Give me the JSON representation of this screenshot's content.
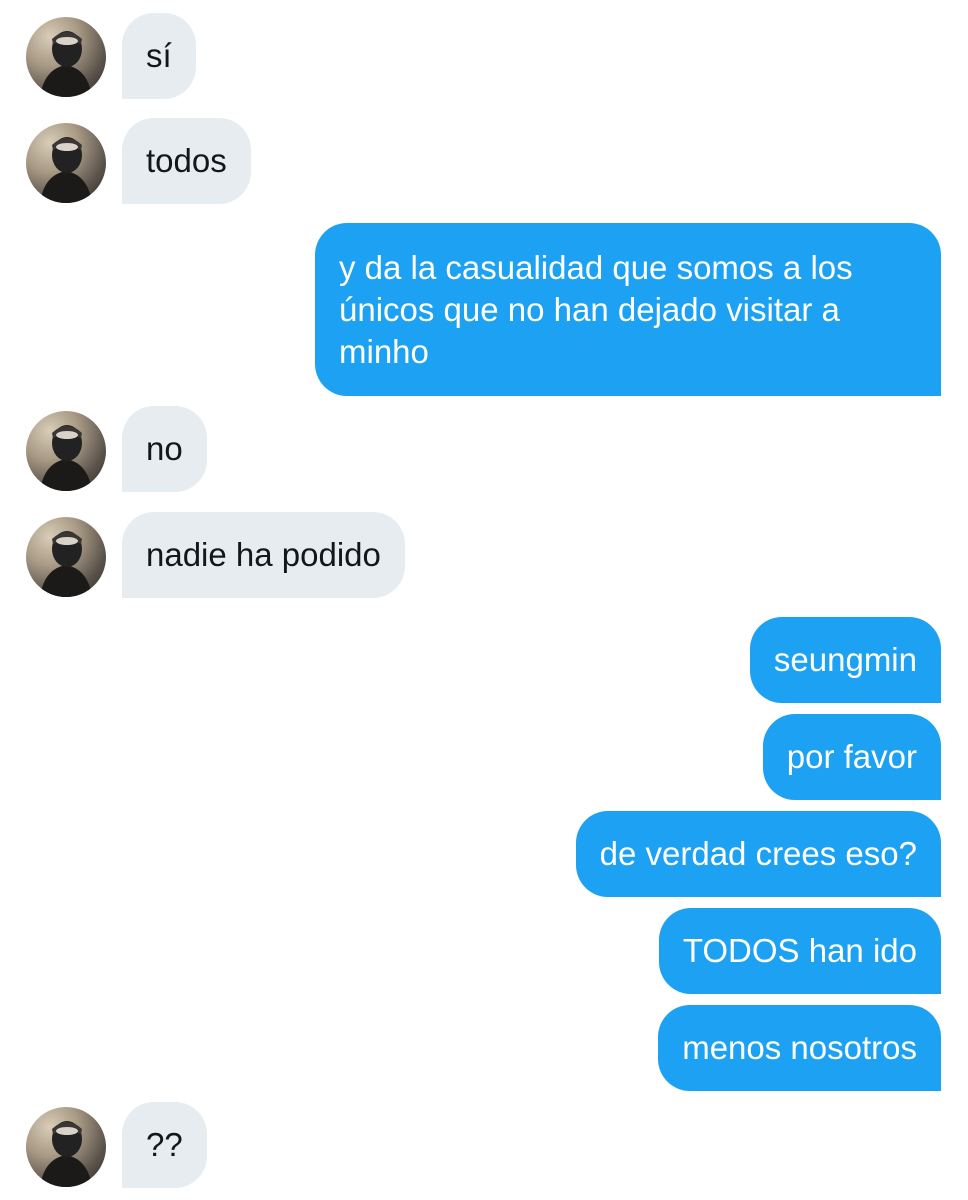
{
  "conversation": {
    "messages": [
      {
        "side": "in",
        "text": "sí"
      },
      {
        "side": "in",
        "text": "todos"
      },
      {
        "side": "out",
        "text": "y da la casualidad que somos a los únicos que no han dejado visitar a minho"
      },
      {
        "side": "in",
        "text": "no"
      },
      {
        "side": "in",
        "text": "nadie ha podido"
      },
      {
        "side": "out",
        "text": "seungmin"
      },
      {
        "side": "out",
        "text": "por favor"
      },
      {
        "side": "out",
        "text": "de verdad crees eso?"
      },
      {
        "side": "out",
        "text": "TODOS han ido"
      },
      {
        "side": "out",
        "text": "menos nosotros"
      },
      {
        "side": "in",
        "text": "??"
      }
    ]
  },
  "colors": {
    "incoming_bubble": "#e6ecf0",
    "outgoing_bubble": "#1da1f2",
    "incoming_text": "#14171a",
    "outgoing_text": "#ffffff"
  },
  "icons": {
    "avatar": "user-avatar-photo"
  }
}
